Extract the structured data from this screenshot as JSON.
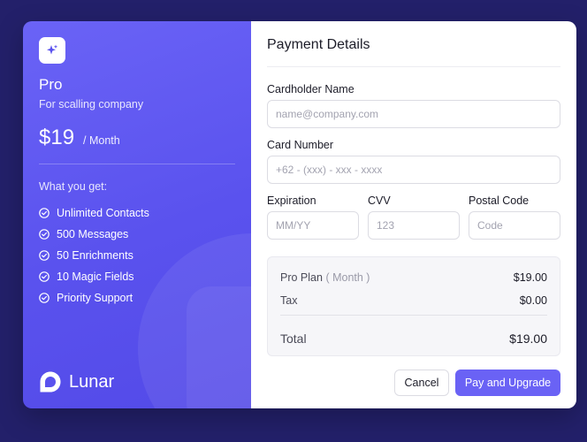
{
  "plan": {
    "name": "Pro",
    "subtitle": "For scalling company",
    "price": "$19",
    "period": "/ Month",
    "features_title": "What you get:",
    "features": [
      "Unlimited Contacts",
      "500 Messages",
      "50 Enrichments",
      "10 Magic Fields",
      "Priority Support"
    ],
    "icon": "sparkle-icon",
    "accent": "#6a63f6"
  },
  "brand": {
    "name": "Lunar",
    "icon": "chat-bubble-logo"
  },
  "payment": {
    "title": "Payment Details",
    "cardholder": {
      "label": "Cardholder Name",
      "placeholder": "name@company.com",
      "value": ""
    },
    "card_number": {
      "label": "Card Number",
      "placeholder": "+62 - (xxx) - xxx - xxxx",
      "value": ""
    },
    "expiration": {
      "label": "Expiration",
      "placeholder": "MM/YY",
      "value": ""
    },
    "cvv": {
      "label": "CVV",
      "placeholder": "123",
      "value": ""
    },
    "postal": {
      "label": "Postal Code",
      "placeholder": "Code",
      "value": ""
    }
  },
  "summary": {
    "plan_label": "Pro Plan",
    "plan_period": "( Month )",
    "plan_amount": "$19.00",
    "tax_label": "Tax",
    "tax_amount": "$0.00",
    "total_label": "Total",
    "total_amount": "$19.00"
  },
  "actions": {
    "cancel": "Cancel",
    "pay": "Pay and Upgrade"
  },
  "colors": {
    "background": "#23206a",
    "primary_button": "#6a62f5"
  }
}
